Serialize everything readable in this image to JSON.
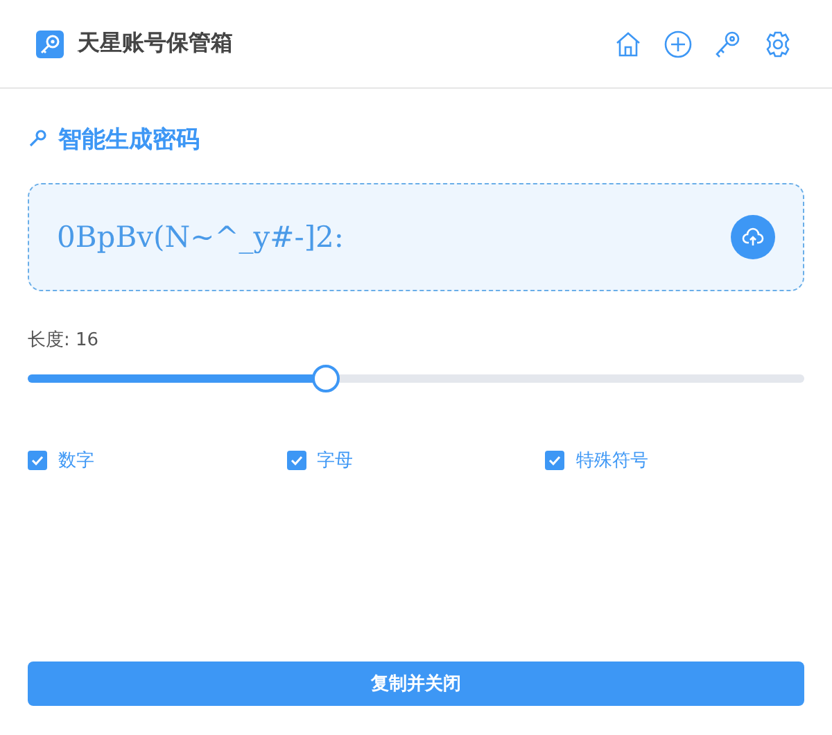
{
  "header": {
    "title": "天星账号保管箱"
  },
  "section": {
    "title": "智能生成密码"
  },
  "password": {
    "value": "0BpBv(N~^_y#-]2:"
  },
  "length": {
    "label": "长度: 16",
    "level": 0.384
  },
  "options": [
    {
      "label": "数字",
      "checked": true
    },
    {
      "label": "字母",
      "checked": true
    },
    {
      "label": "特殊符号",
      "checked": true
    }
  ],
  "button": {
    "label": "复制并关闭"
  }
}
